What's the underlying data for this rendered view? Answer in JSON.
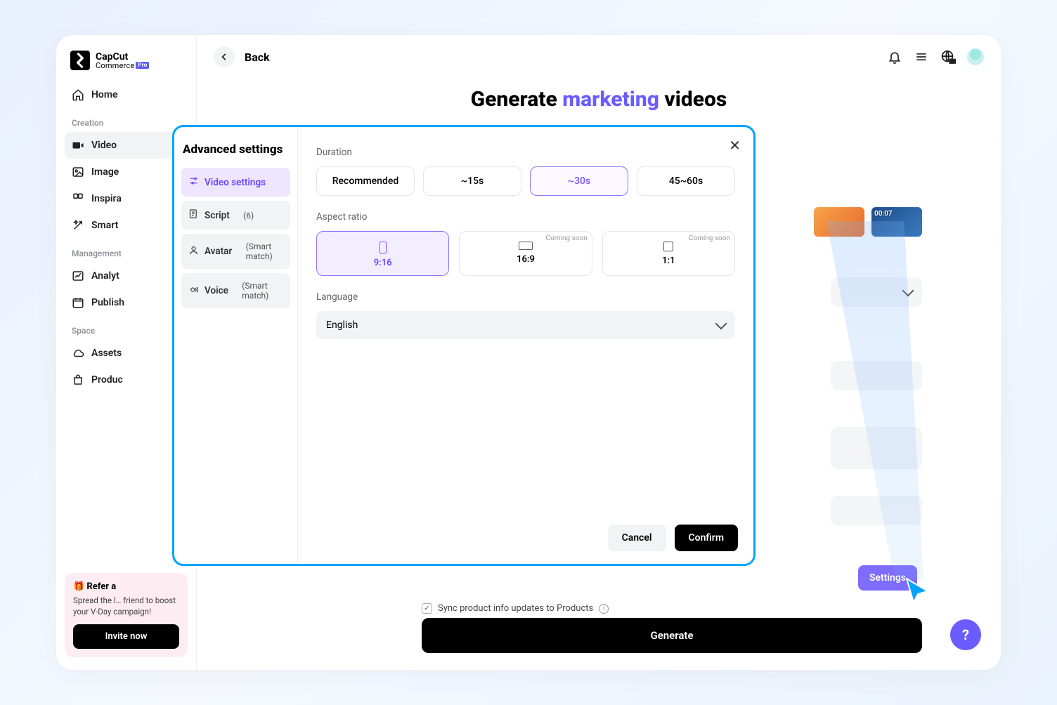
{
  "brand": {
    "line1": "CapCut",
    "line2": "Commerce",
    "badge": "Pro"
  },
  "sidebar": {
    "home": "Home",
    "sections": {
      "creation": "Creation",
      "management": "Management",
      "space": "Space"
    },
    "items": {
      "video": "Video",
      "image": "Image",
      "inspiration": "Inspira",
      "smart": "Smart",
      "analytics": "Analyt",
      "publish": "Publish",
      "assets": "Assets",
      "products": "Produc"
    }
  },
  "refer": {
    "title": "🎁 Refer a",
    "desc": "Spread the l… friend to boost your V-Day campaign!",
    "button": "Invite now"
  },
  "topbar": {
    "back": "Back"
  },
  "page": {
    "title_pre": "Generate ",
    "title_accent": "marketing",
    "title_post": " videos",
    "thumb_duration": "00:07",
    "sync_label": "Sync product info updates to Products",
    "settings_btn": "Settings",
    "generate_btn": "Generate"
  },
  "modal": {
    "title": "Advanced settings",
    "tabs": {
      "video": "Video settings",
      "script": "Script",
      "script_count": "(6)",
      "avatar": "Avatar",
      "avatar_sub": "(Smart match)",
      "voice": "Voice",
      "voice_sub": "(Smart match)"
    },
    "duration": {
      "label": "Duration",
      "options": [
        "Recommended",
        "~15s",
        "~30s",
        "45~60s"
      ],
      "selected": "~30s"
    },
    "aspect": {
      "label": "Aspect ratio",
      "options": [
        {
          "label": "9:16",
          "w": 10,
          "h": 17
        },
        {
          "label": "16:9",
          "w": 20,
          "h": 12,
          "soon": "Coming soon"
        },
        {
          "label": "1:1",
          "w": 14,
          "h": 14,
          "soon": "Coming soon"
        }
      ],
      "selected": "9:16"
    },
    "language": {
      "label": "Language",
      "value": "English"
    },
    "cancel": "Cancel",
    "confirm": "Confirm"
  }
}
